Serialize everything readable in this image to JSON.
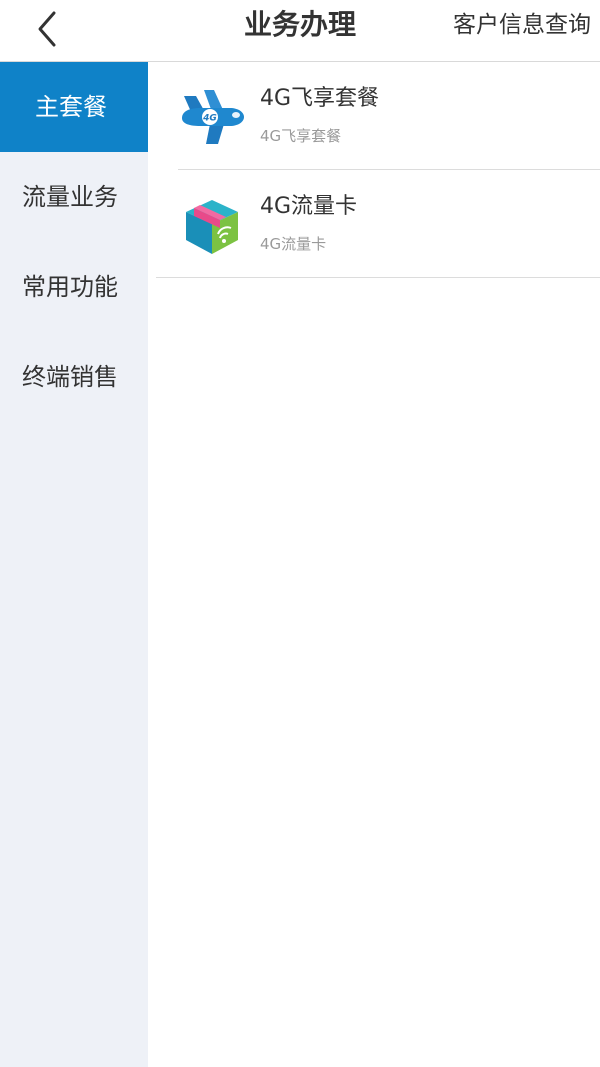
{
  "header": {
    "title": "业务办理",
    "action_label": "客户信息查询"
  },
  "sidebar": {
    "items": [
      {
        "label": "主套餐",
        "active": true
      },
      {
        "label": "流量业务",
        "active": false
      },
      {
        "label": "常用功能",
        "active": false
      },
      {
        "label": "终端销售",
        "active": false
      }
    ]
  },
  "products": [
    {
      "name": "4G飞享套餐",
      "subtitle": "4G飞享套餐",
      "icon": "airplane-icon",
      "icon_badge": "4G"
    },
    {
      "name": "4G流量卡",
      "subtitle": "4G流量卡",
      "icon": "package-box-icon"
    }
  ],
  "colors": {
    "accent": "#0f82c8",
    "sidebar_bg": "#eef1f7"
  }
}
